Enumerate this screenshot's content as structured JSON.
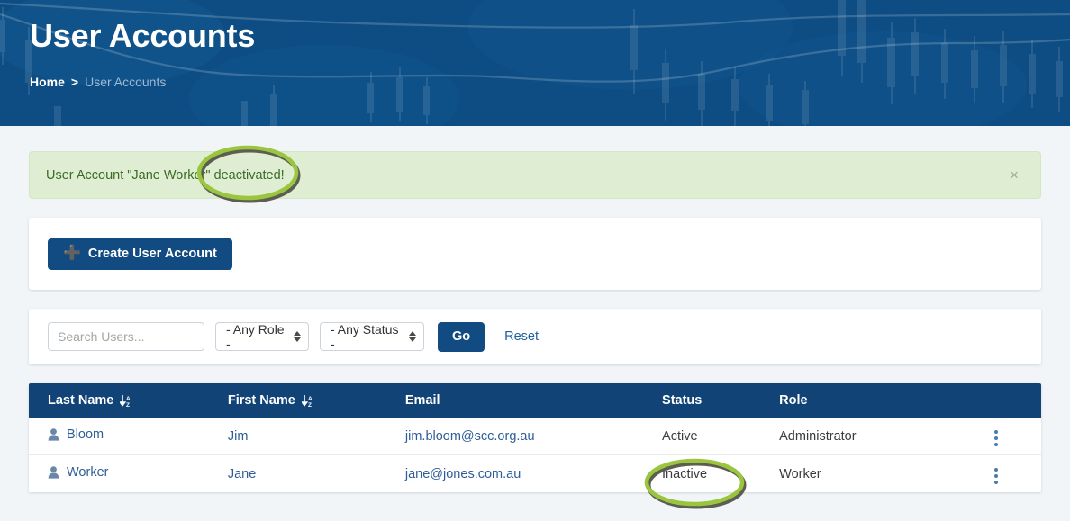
{
  "header": {
    "title": "User Accounts",
    "breadcrumb": {
      "home": "Home",
      "separator": ">",
      "current": "User Accounts"
    },
    "background_color": "#0d4d87"
  },
  "alert": {
    "message": "User Account \"Jane Worker\" deactivated!",
    "close_label": "×",
    "background_color": "#dfeed2",
    "text_color": "#3b6b26"
  },
  "toolbar": {
    "create_label": "Create User Account",
    "create_icon": "plus-icon",
    "button_color": "#124b82"
  },
  "filters": {
    "search_placeholder": "Search Users...",
    "search_value": "",
    "role_selected": "- Any Role -",
    "status_selected": "- Any Status -",
    "go_label": "Go",
    "reset_label": "Reset"
  },
  "table": {
    "header_color": "#114377",
    "columns": [
      {
        "label": "Last Name",
        "sortable": true
      },
      {
        "label": "First Name",
        "sortable": true
      },
      {
        "label": "Email",
        "sortable": false
      },
      {
        "label": "Status",
        "sortable": false
      },
      {
        "label": "Role",
        "sortable": false
      }
    ],
    "rows": [
      {
        "last_name": "Bloom",
        "first_name": "Jim",
        "email": "jim.bloom@scc.org.au",
        "status": "Active",
        "role": "Administrator"
      },
      {
        "last_name": "Worker",
        "first_name": "Jane",
        "email": "jane@jones.com.au",
        "status": "Inactive",
        "role": "Worker"
      }
    ]
  },
  "annotations": {
    "highlight_color": "#9ac63f",
    "shadow_color": "#5d5d52"
  }
}
